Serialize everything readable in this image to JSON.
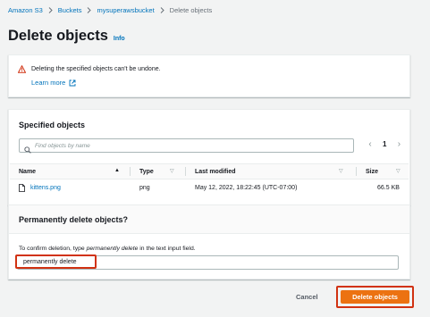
{
  "breadcrumb": {
    "items": [
      "Amazon S3",
      "Buckets",
      "mysuperawsbucket"
    ],
    "current": "Delete objects"
  },
  "header": {
    "title": "Delete objects",
    "info": "Info"
  },
  "warning": {
    "message": "Deleting the specified objects can't be undone.",
    "learn_more": "Learn more"
  },
  "specified_objects": {
    "title": "Specified objects",
    "search_placeholder": "Find objects by name",
    "page": "1",
    "columns": [
      "Name",
      "Type",
      "Last modified",
      "Size"
    ],
    "rows": [
      {
        "name": "kittens.png",
        "type": "png",
        "last_modified": "May 12, 2022, 18:22:45 (UTC-07:00)",
        "size": "66.5 KB"
      }
    ]
  },
  "permanent_delete": {
    "title": "Permanently delete objects?",
    "instruction_prefix": "To confirm deletion, type ",
    "instruction_keyword": "permanently delete",
    "instruction_suffix": " in the text input field.",
    "input_value": "permanently delete"
  },
  "actions": {
    "cancel": "Cancel",
    "delete": "Delete objects"
  },
  "colors": {
    "link": "#0073bb",
    "primary": "#ec7211",
    "highlight": "#d13212"
  }
}
